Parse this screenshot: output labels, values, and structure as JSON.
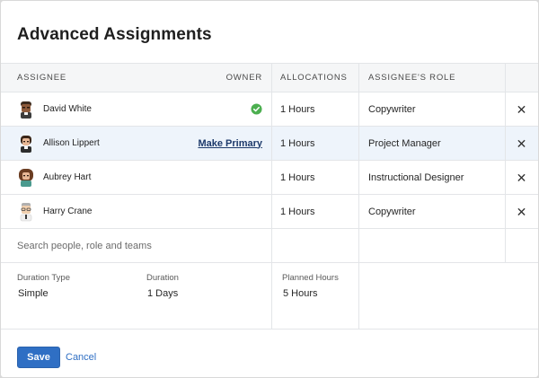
{
  "dialog": {
    "title": "Advanced Assignments"
  },
  "table": {
    "headers": {
      "assignee": "ASSIGNEE",
      "owner": "OWNER",
      "allocations": "ALLOCATIONS",
      "role": "ASSIGNEE'S ROLE"
    },
    "rows": [
      {
        "name": "David White",
        "owner": "check-circle-icon",
        "allocation": "1 Hours",
        "role": "Copywriter",
        "avatar": "avatar-david-icon",
        "highlighted": false
      },
      {
        "name": "Allison Lippert",
        "owner_action": "Make Primary",
        "allocation": "1 Hours",
        "role": "Project Manager",
        "avatar": "avatar-allison-icon",
        "highlighted": true
      },
      {
        "name": "Aubrey Hart",
        "allocation": "1 Hours",
        "role": "Instructional Designer",
        "avatar": "avatar-aubrey-icon",
        "highlighted": false
      },
      {
        "name": "Harry Crane",
        "allocation": "1 Hours",
        "role": "Copywriter",
        "avatar": "avatar-harry-icon",
        "highlighted": false
      }
    ],
    "search_placeholder": "Search people, role and teams",
    "remove_icon": "close-icon"
  },
  "details": {
    "duration_type_label": "Duration Type",
    "duration_type_value": "Simple",
    "duration_label": "Duration",
    "duration_value": "1 Days",
    "planned_hours_label": "Planned Hours",
    "planned_hours_value": "5 Hours"
  },
  "footer": {
    "save_label": "Save",
    "cancel_label": "Cancel"
  },
  "colors": {
    "primary": "#2f6fc4",
    "owner_check": "#4caf50",
    "row_highlight": "#eef4fb"
  }
}
